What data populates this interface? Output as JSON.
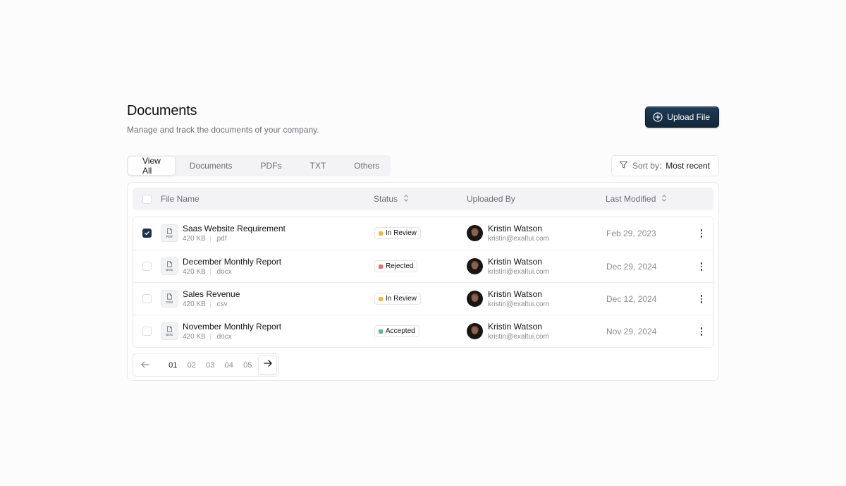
{
  "header": {
    "title": "Documents",
    "subtitle": "Manage and track the documents of your company.",
    "upload_label": "Upload File"
  },
  "tabs": [
    {
      "label": "View All",
      "active": true
    },
    {
      "label": "Documents",
      "active": false
    },
    {
      "label": "PDFs",
      "active": false
    },
    {
      "label": "TXT",
      "active": false
    },
    {
      "label": "Others",
      "active": false
    }
  ],
  "sort": {
    "prefix": "Sort by:",
    "value": "Most recent"
  },
  "table": {
    "columns": {
      "file_name": "File Name",
      "status": "Status",
      "uploaded_by": "Uploaded By",
      "last_modified": "Last Modified"
    },
    "rows": [
      {
        "checked": true,
        "icon_ext": "PDF",
        "name": "Saas Website Requirement",
        "size": "420 KB",
        "ext": ".pdf",
        "status": "In Review",
        "status_color": "#f5b83d",
        "user": "Kristin Watson",
        "email": "kristin@exaltui.com",
        "date": "Feb 29, 2023"
      },
      {
        "checked": false,
        "icon_ext": "DOC",
        "name": "December Monthly Report",
        "size": "420 KB",
        "ext": ".docx",
        "status": "Rejected",
        "status_color": "#ef6b6b",
        "user": "Kristin Watson",
        "email": "kristin@exaltui.com",
        "date": "Dec 29, 2024"
      },
      {
        "checked": false,
        "icon_ext": "CSV",
        "name": "Sales Revenue",
        "size": "420 KB",
        "ext": ".csv",
        "status": "In Review",
        "status_color": "#f5b83d",
        "user": "Kristin Watson",
        "email": "kristin@exaltui.com",
        "date": "Dec 12, 2024"
      },
      {
        "checked": false,
        "icon_ext": "DOC",
        "name": "November Monthly Report",
        "size": "420 KB",
        "ext": ".docx",
        "status": "Accepted",
        "status_color": "#5cb88a",
        "user": "Kristin Watson",
        "email": "kristin@exaltui.com",
        "date": "Nov 29, 2024"
      }
    ]
  },
  "pagination": {
    "pages": [
      "01",
      "02",
      "03",
      "04",
      "05"
    ],
    "current": "01"
  },
  "colors": {
    "primary": "#1b3149",
    "muted_text": "#6b6f76"
  }
}
